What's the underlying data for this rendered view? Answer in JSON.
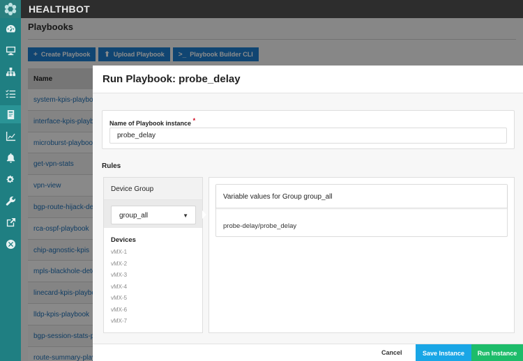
{
  "app": {
    "brand": "HEALTHBOT"
  },
  "sidebar": {
    "icons": [
      "dashboard-icon",
      "monitor-icon",
      "topology-icon",
      "checklist-icon",
      "playbook-icon",
      "chart-icon",
      "alert-bell-icon",
      "settings-gears-icon",
      "wrench-icon",
      "external-link-icon",
      "close-circle-icon"
    ],
    "active": "playbook-icon"
  },
  "page": {
    "title": "Playbooks",
    "buttons": [
      {
        "glyph": "+",
        "label": "Create Playbook"
      },
      {
        "glyph": "⬆",
        "label": "Upload Playbook"
      },
      {
        "glyph": ">_",
        "label": "Playbook Builder CLI"
      }
    ],
    "table": {
      "header": "Name",
      "rows": [
        "system-kpis-playbook",
        "interface-kpis-playbook",
        "microburst-playbook",
        "get-vpn-stats",
        "vpn-view",
        "bgp-route-hijack-detection",
        "rca-ospf-playbook",
        "chip-agnostic-kpis",
        "mpls-blackhole-detection",
        "linecard-kpis-playbook",
        "lldp-kpis-playbook",
        "bgp-session-stats-playbook",
        "route-summary-playbook"
      ]
    }
  },
  "modal": {
    "title": "Run Playbook: probe_delay",
    "name_label": "Name of Playbook instance",
    "required_mark": "*",
    "name_value": "probe_delay",
    "rules_label": "Rules",
    "device_group": {
      "title": "Device Group",
      "selected": "group_all",
      "caret": "▼",
      "devices_title": "Devices",
      "devices": [
        "vMX-1",
        "vMX-2",
        "vMX-3",
        "vMX-4",
        "vMX-5",
        "vMX-6",
        "vMX-7"
      ]
    },
    "variables": {
      "title": "Variable values for Group group_all",
      "rules": [
        "probe-delay/probe_delay"
      ]
    },
    "footer": {
      "cancel": "Cancel",
      "save": "Save Instance",
      "run": "Run Instance"
    }
  },
  "colors": {
    "sidebar": "#1f7f82",
    "topbar": "#2d2d2d",
    "primary_blue": "#1e7fd0",
    "save_blue": "#19a6e6",
    "run_green": "#1dbc6a"
  }
}
